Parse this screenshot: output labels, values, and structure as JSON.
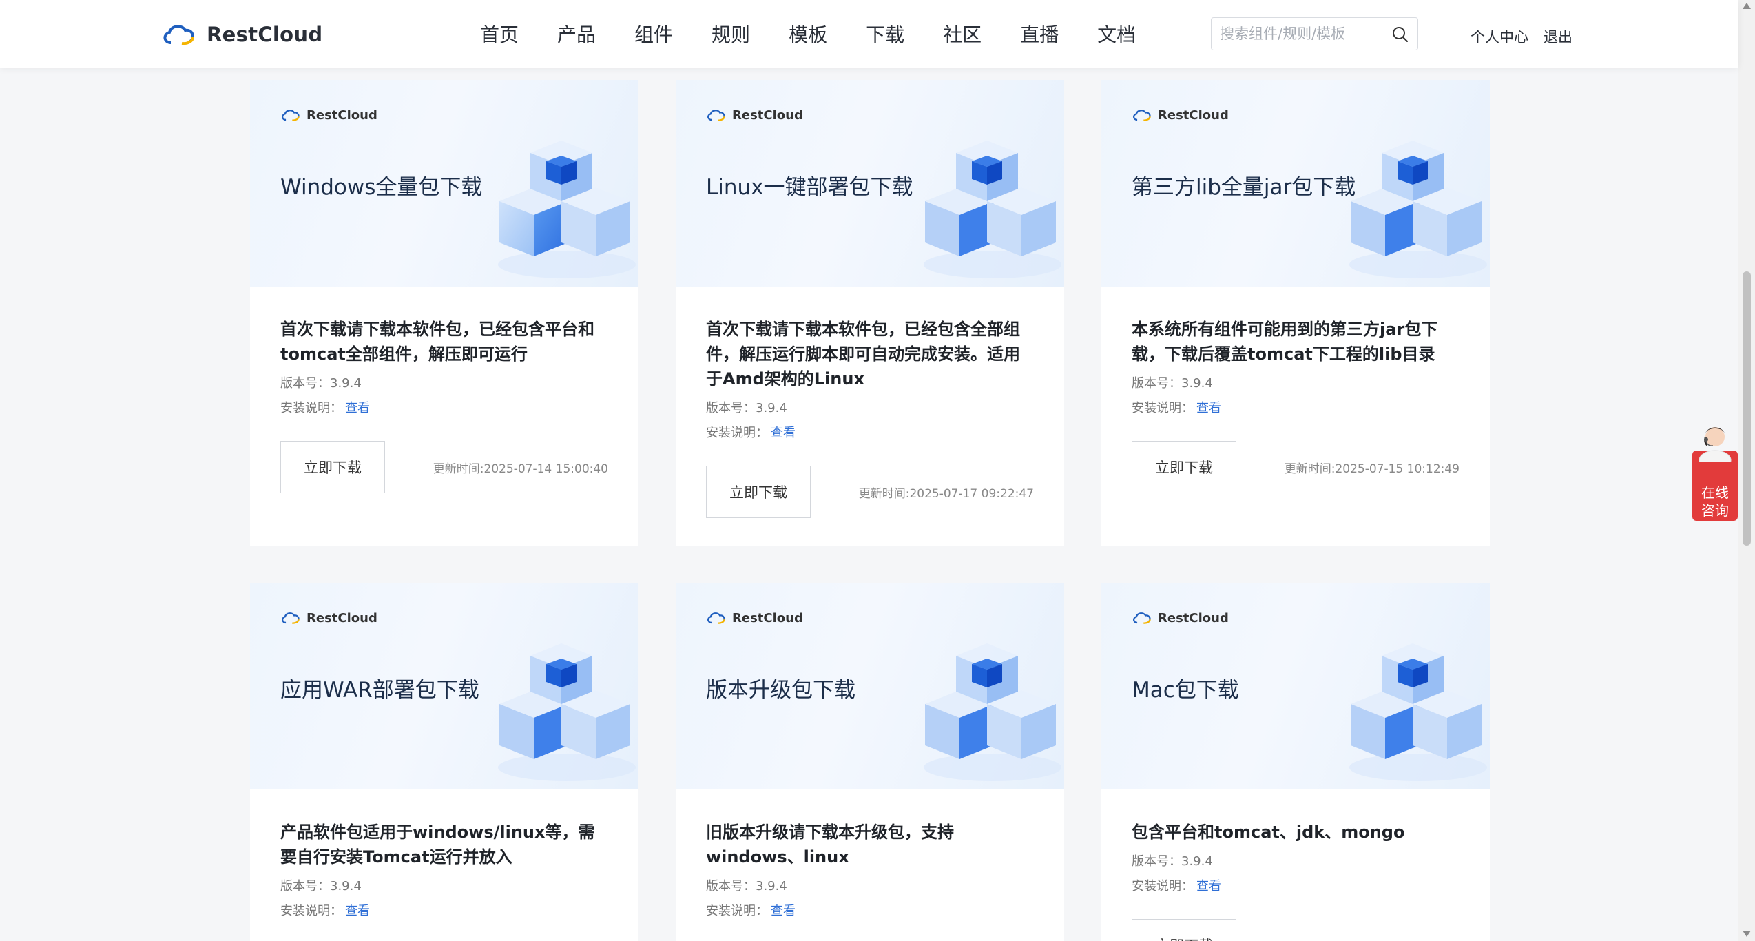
{
  "header": {
    "brand": "RestCloud",
    "nav": [
      "首页",
      "产品",
      "组件",
      "规则",
      "模板",
      "下载",
      "社区",
      "直播",
      "文档"
    ],
    "search_placeholder": "搜索组件/规则/模板",
    "user_center": "个人中心",
    "logout": "退出"
  },
  "cards": [
    {
      "brand": "RestCloud",
      "banner_title": "Windows全量包下载",
      "description": "首次下载请下载本软件包，已经包含平台和tomcat全部组件，解压即可运行",
      "version_label": "版本号：",
      "version": "3.9.4",
      "install_label": "安装说明：",
      "install_link": "查看",
      "button": "立即下载",
      "updated": "更新时间:2025-07-14 15:00:40"
    },
    {
      "brand": "RestCloud",
      "banner_title": "Linux一键部署包下载",
      "description": "首次下载请下载本软件包，已经包含全部组件，解压运行脚本即可自动完成安装。适用于Amd架构的Linux",
      "version_label": "版本号：",
      "version": "3.9.4",
      "install_label": "安装说明：",
      "install_link": "查看",
      "button": "立即下载",
      "updated": "更新时间:2025-07-17 09:22:47"
    },
    {
      "brand": "RestCloud",
      "banner_title": "第三方lib全量jar包下载",
      "description": "本系统所有组件可能用到的第三方jar包下载，下载后覆盖tomcat下工程的lib目录",
      "version_label": "版本号：",
      "version": "3.9.4",
      "install_label": "安装说明：",
      "install_link": "查看",
      "button": "立即下载",
      "updated": "更新时间:2025-07-15 10:12:49"
    },
    {
      "brand": "RestCloud",
      "banner_title": "应用WAR部署包下载",
      "description": "产品软件包适用于windows/linux等，需要自行安装Tomcat运行并放入",
      "version_label": "版本号：",
      "version": "3.9.4",
      "install_label": "安装说明：",
      "install_link": "查看"
    },
    {
      "brand": "RestCloud",
      "banner_title": "版本升级包下载",
      "description": "旧版本升级请下载本升级包，支持windows、linux",
      "version_label": "版本号：",
      "version": "3.9.4",
      "install_label": "安装说明：",
      "install_link": "查看"
    },
    {
      "brand": "RestCloud",
      "banner_title": "Mac包下载",
      "description": "包含平台和tomcat、jdk、mongo",
      "version_label": "版本号：",
      "version": "3.9.4",
      "install_label": "安装说明：",
      "install_link": "查看",
      "button": "立即下载"
    }
  ],
  "chat": {
    "label_line1": "在线",
    "label_line2": "咨询"
  },
  "icons": {
    "logo": "cloud-logo-icon",
    "search": "search-icon",
    "banner": "cubes-illustration-icon",
    "chat": "support-agent-icon"
  },
  "colors": {
    "link": "#2f6fd6",
    "chat": "#e23b3b",
    "logo_blue": "#1f5fbf",
    "logo_yellow": "#f5b400"
  }
}
